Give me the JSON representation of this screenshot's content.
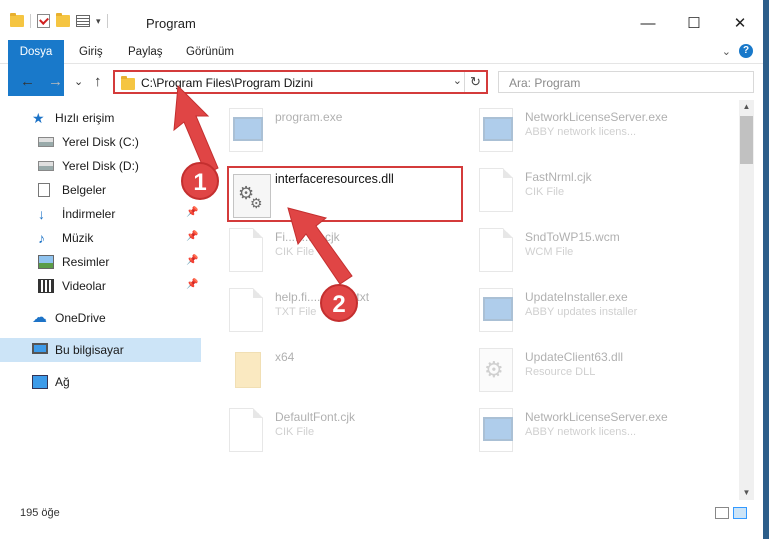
{
  "window": {
    "title": "Program",
    "min_glyph": "—",
    "max_glyph": "☐",
    "close_glyph": "✕"
  },
  "ribbon": {
    "tabs": [
      "Dosya",
      "Giriş",
      "Paylaş",
      "Görünüm"
    ],
    "expand_glyph": "⌄",
    "help_glyph": "?"
  },
  "nav": {
    "back_glyph": "←",
    "forward_glyph": "→",
    "recent_glyph": "⌄",
    "up_glyph": "↑",
    "address": "C:\\Program Files\\Program Dizini",
    "address_dropdown_glyph": "⌄",
    "refresh_glyph": "↻",
    "search_placeholder": "Ara: Program"
  },
  "sidebar": {
    "quick_access": "Hızlı erişim",
    "items": [
      {
        "label": "Yerel Disk (C:)",
        "pinned": false
      },
      {
        "label": "Yerel Disk (D:)",
        "pinned": false
      },
      {
        "label": "Belgeler",
        "pinned": true
      },
      {
        "label": "İndirmeler",
        "pinned": true
      },
      {
        "label": "Müzik",
        "pinned": true
      },
      {
        "label": "Resimler",
        "pinned": true
      },
      {
        "label": "Videolar",
        "pinned": true
      }
    ],
    "onedrive": "OneDrive",
    "this_pc": "Bu bilgisayar",
    "network": "Ağ"
  },
  "files": {
    "left": [
      {
        "name": "program.exe",
        "desc": "",
        "icon": "exe"
      },
      {
        "name": "Fi..........t.cjk",
        "desc": "CIK File",
        "icon": "blank"
      },
      {
        "name": "help.fi..........ler.txt",
        "desc": "TXT File",
        "icon": "blank"
      },
      {
        "name": "x64",
        "desc": "",
        "icon": "folder"
      },
      {
        "name": "DefaultFont.cjk",
        "desc": "CIK File",
        "icon": "blank"
      }
    ],
    "right": [
      {
        "name": "NetworkLicenseServer.exe",
        "desc": "ABBY network licens...",
        "icon": "exe"
      },
      {
        "name": "FastNrml.cjk",
        "desc": "CIK File",
        "icon": "blank"
      },
      {
        "name": "SndToWP15.wcm",
        "desc": "WCM File",
        "icon": "blank"
      },
      {
        "name": "UpdateInstaller.exe",
        "desc": "ABBY updates installer",
        "icon": "exe"
      },
      {
        "name": "UpdateClient63.dll",
        "desc": "Resource DLL",
        "icon": "dll"
      },
      {
        "name": "NetworkLicenseServer.exe",
        "desc": "ABBY network licens...",
        "icon": "exe"
      }
    ],
    "highlighted": {
      "name": "interfaceresources.dll"
    }
  },
  "annotations": {
    "step1": "1",
    "step2": "2",
    "color": "#e04545"
  },
  "status": {
    "count": "195 öğe"
  }
}
